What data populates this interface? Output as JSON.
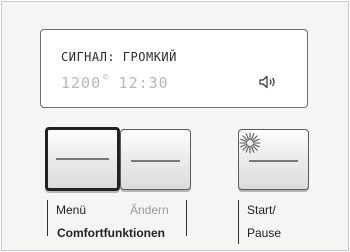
{
  "display": {
    "line1": "СИГНАЛ: ГРОМКИЙ",
    "rpm": "1200",
    "degree_symbol": "©",
    "time": "12:30",
    "sound_icon": "speaker-icon"
  },
  "buttons": {
    "menu_label": "Menü",
    "change_label": "Ändern",
    "group_label": "Comfortfunktionen",
    "start_label_line1": "Start/",
    "start_label_line2": "Pause",
    "start_icon": "starburst-icon"
  },
  "colors": {
    "panel_background": "#f5f5f3",
    "display_inactive_digits": "#b8b8b8",
    "text": "#222222",
    "disabled_label": "#9a9a9a"
  }
}
